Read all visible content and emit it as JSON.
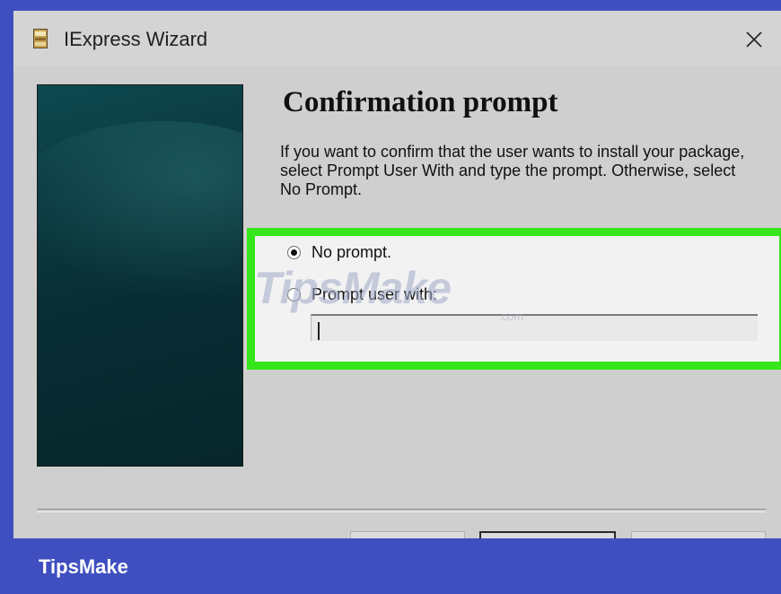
{
  "window": {
    "title": "IExpress Wizard",
    "icon": "iexpress-app-icon",
    "close_icon": "close-icon"
  },
  "page": {
    "heading": "Confirmation prompt",
    "description": "If you want to confirm that the user wants to install your package, select Prompt User With and type the prompt. Otherwise, select No Prompt."
  },
  "options": {
    "no_prompt_label": "No prompt.",
    "no_prompt_selected": true,
    "prompt_user_label": "Prompt user with:",
    "prompt_user_selected": false,
    "prompt_text_value": ""
  },
  "watermark": {
    "brand": "TipsMake",
    "suffix": ".com"
  },
  "footer": {
    "brand": "TipsMake"
  },
  "colors": {
    "frame": "#3f4fbf",
    "highlight": "#35e61a",
    "window_bg": "#cfcfcf"
  }
}
